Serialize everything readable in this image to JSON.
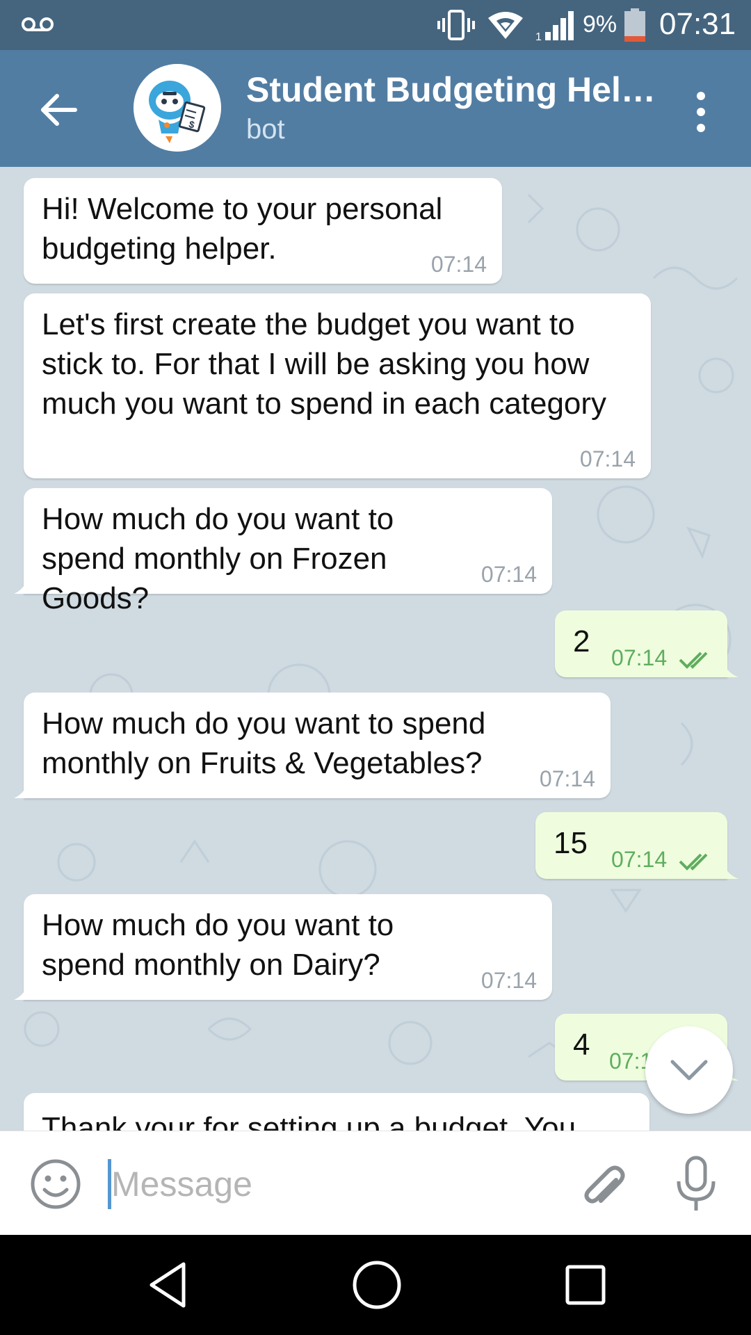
{
  "status_bar": {
    "battery_percent": "9%",
    "time": "07:31",
    "icons": [
      "voicemail-icon",
      "vibrate-icon",
      "wifi-icon",
      "signal-icon",
      "battery-low-icon"
    ]
  },
  "header": {
    "title": "Student Budgeting Hel…",
    "subtitle": "bot",
    "colors": {
      "status_bar": "#45657f",
      "app_bar": "#527da3"
    }
  },
  "messages": [
    {
      "direction": "in",
      "text": "Hi! Welcome to your personal budgeting helper.",
      "time": "07:14"
    },
    {
      "direction": "in",
      "text": "Let's first create the budget you want to stick to. For that I will be asking you how much you want to spend in each category",
      "time": "07:14"
    },
    {
      "direction": "in",
      "text": "How much do you want to spend monthly on Frozen Goods?",
      "time": "07:14"
    },
    {
      "direction": "out",
      "text": "2",
      "time": "07:14",
      "status": "read"
    },
    {
      "direction": "in",
      "text": "How much do you want to spend monthly on Fruits & Vegetables?",
      "time": "07:14"
    },
    {
      "direction": "out",
      "text": "15",
      "time": "07:14",
      "status": "read"
    },
    {
      "direction": "in",
      "text": "How much do you want to spend monthly on Dairy?",
      "time": "07:14"
    },
    {
      "direction": "out",
      "text": "4",
      "time": "07:1",
      "status": "read"
    },
    {
      "direction": "in",
      "text": "Thank your for setting up a budget. You",
      "time": ""
    }
  ],
  "composer": {
    "placeholder": "Message",
    "value": ""
  },
  "colors": {
    "chat_background": "#cfdae1",
    "incoming_bubble": "#ffffff",
    "outgoing_bubble": "#effdde",
    "outgoing_meta": "#5fad5f"
  }
}
